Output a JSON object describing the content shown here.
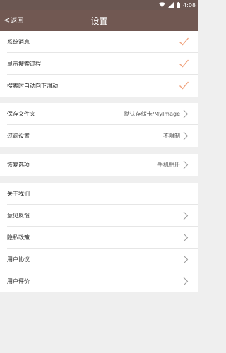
{
  "status_bar": {
    "time": "4:08"
  },
  "header": {
    "back_label": "返回",
    "title": "设置"
  },
  "groups": [
    {
      "items": [
        {
          "label": "系统消息"
        },
        {
          "label": "显示搜索过程"
        },
        {
          "label": "搜索时自动向下滑动"
        }
      ]
    },
    {
      "items": [
        {
          "label": "保存文件夹",
          "value": "默认存储卡/MyImage"
        },
        {
          "label": "过滤设置",
          "value": "不限制"
        }
      ]
    },
    {
      "items": [
        {
          "label": "恢复选项",
          "value": "手机相册"
        }
      ]
    },
    {
      "items": [
        {
          "label": "关于我们"
        },
        {
          "label": "意见反馈"
        },
        {
          "label": "隐私政策"
        },
        {
          "label": "用户协议"
        },
        {
          "label": "用户评价"
        }
      ]
    }
  ],
  "colors": {
    "header_bg": "#715852",
    "status_bg": "#6b5752",
    "check": "#f0a07a",
    "page_bg": "#efefef"
  }
}
